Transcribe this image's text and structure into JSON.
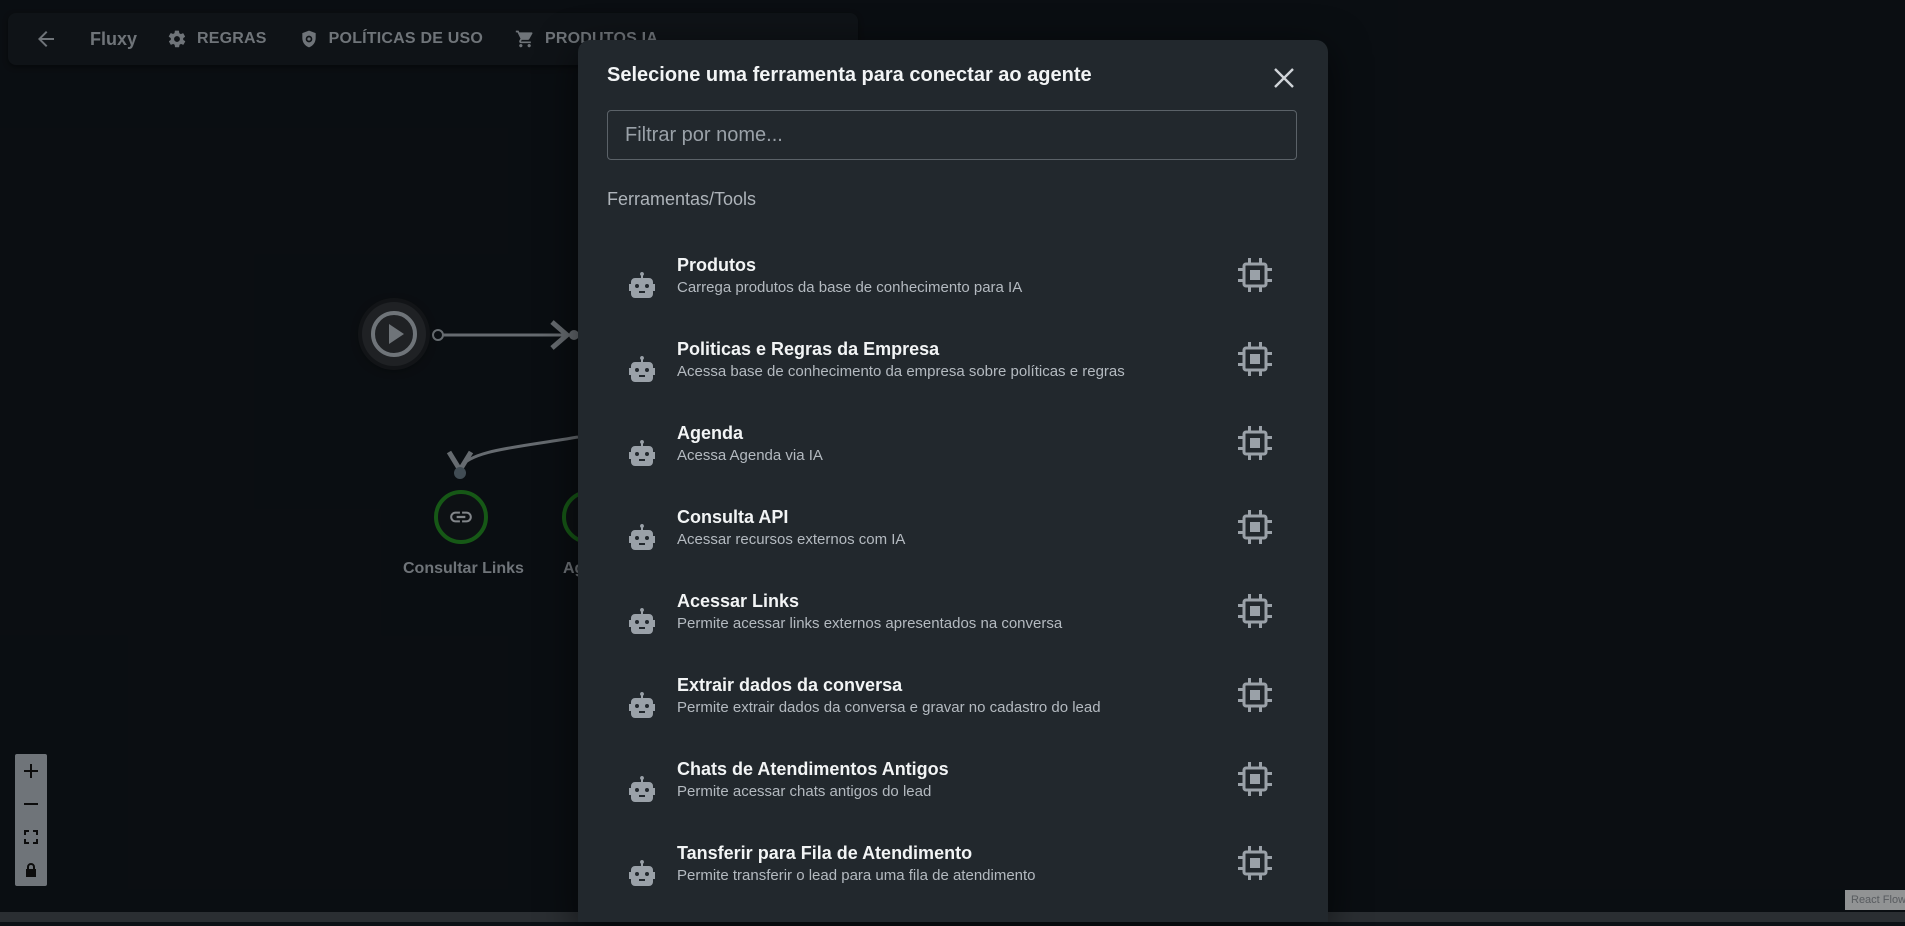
{
  "topbar": {
    "brand": "Fluxy",
    "nav": [
      {
        "label": "REGRAS",
        "icon": "gear-icon"
      },
      {
        "label": "POLÍTICAS DE USO",
        "icon": "shield-icon"
      },
      {
        "label": "PRODUTOS IA",
        "icon": "cart-icon"
      }
    ]
  },
  "canvas": {
    "nodes": [
      {
        "label": "Consultar Links"
      },
      {
        "label": "Ag"
      }
    ],
    "watermark": "React Flow"
  },
  "modal": {
    "title": "Selecione uma ferramenta para conectar ao agente",
    "filter_placeholder": "Filtrar por nome...",
    "section_label": "Ferramentas/Tools",
    "items": [
      {
        "title": "Produtos",
        "desc": "Carrega produtos da base de conhecimento para IA"
      },
      {
        "title": "Politicas e Regras da Empresa",
        "desc": "Acessa base de conhecimento da empresa sobre políticas e regras"
      },
      {
        "title": "Agenda",
        "desc": "Acessa Agenda via IA"
      },
      {
        "title": "Consulta API",
        "desc": "Acessar recursos externos com IA"
      },
      {
        "title": "Acessar Links",
        "desc": "Permite acessar links externos apresentados na conversa"
      },
      {
        "title": "Extrair dados da conversa",
        "desc": "Permite extrair dados da conversa e gravar no cadastro do lead"
      },
      {
        "title": "Chats de Atendimentos Antigos",
        "desc": "Permite acessar chats antigos do lead"
      },
      {
        "title": "Tansferir para Fila de Atendimento",
        "desc": "Permite transferir o lead para uma fila de atendimento"
      }
    ]
  }
}
